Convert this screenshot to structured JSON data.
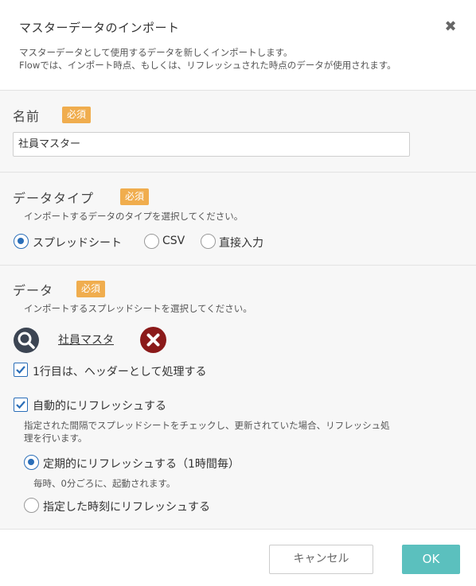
{
  "dialog": {
    "title": "マスターデータのインポート",
    "close_icon": "close-icon",
    "description_line1": "マスターデータとして使用するデータを新しくインポートします。",
    "description_line2": "Flowでは、インポート時点、もしくは、リフレッシュされた時点のデータが使用されます。"
  },
  "name_section": {
    "label": "名前",
    "required_badge": "必須",
    "value": "社員マスター"
  },
  "type_section": {
    "label": "データタイプ",
    "required_badge": "必須",
    "hint": "インポートするデータのタイプを選択してください。",
    "options": [
      {
        "label": "スプレッドシート",
        "selected": true
      },
      {
        "label": "CSV",
        "selected": false
      },
      {
        "label": "直接入力",
        "selected": false
      }
    ]
  },
  "data_section": {
    "label": "データ",
    "required_badge": "必須",
    "hint": "インポートするスプレッドシートを選択してください。",
    "selected_file": "社員マスタ",
    "header_row_checkbox": {
      "label": "1行目は、ヘッダーとして処理する",
      "checked": true
    },
    "auto_refresh_checkbox": {
      "label": "自動的にリフレッシュする",
      "checked": true
    },
    "auto_refresh_hint_line1": "指定された間隔でスプレッドシートをチェックし、更新されていた場合、リフレッシュ処",
    "auto_refresh_hint_line2": "理を行います。",
    "refresh_options": [
      {
        "label": "定期的にリフレッシュする（1時間毎）",
        "selected": true,
        "sub": "毎時、0分ごろに、起動されます。"
      },
      {
        "label": "指定した時刻にリフレッシュする",
        "selected": false
      }
    ]
  },
  "footer": {
    "cancel_label": "キャンセル",
    "ok_label": "OK"
  },
  "colors": {
    "badge": "#f0ad4e",
    "ok_button": "#5bc0be",
    "accent": "#2a6eb8",
    "remove": "#8b1a1a"
  }
}
